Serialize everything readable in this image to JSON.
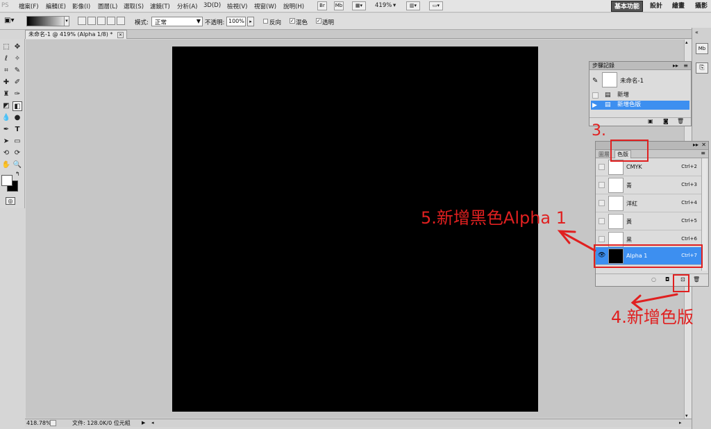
{
  "app_logo": "PS",
  "menu": [
    "檔案(F)",
    "編輯(E)",
    "影像(I)",
    "圖層(L)",
    "選取(S)",
    "濾鏡(T)",
    "分析(A)",
    "3D(D)",
    "檢視(V)",
    "視窗(W)",
    "說明(H)"
  ],
  "menu_icons": {
    "bridge": "Br",
    "mini_bridge": "Mb",
    "zoom": "419%"
  },
  "workspaces": [
    "基本功能",
    "設計",
    "繪畫",
    "攝影"
  ],
  "options": {
    "mode_label": "模式:",
    "mode_value": "正常",
    "opacity_label": "不透明:",
    "opacity_value": "100%",
    "reverse_label": "反向",
    "dither_label": "混色",
    "transparency_label": "透明"
  },
  "document": {
    "tab_title": "未命名-1 @ 419% (Alpha 1/8) *",
    "zoom_status": "418.78%",
    "file_info": "文件: 128.0K/0 位元組",
    "canvas_color": "#000000"
  },
  "history": {
    "title": "步驟記錄",
    "snapshot": "未命名-1",
    "steps": [
      "新增",
      "新增色版"
    ]
  },
  "channels": {
    "tab_layers": "圖層",
    "tab_channels": "色版",
    "rows": [
      {
        "name": "CMYK",
        "shortcut": "Ctrl+2"
      },
      {
        "name": "青",
        "shortcut": "Ctrl+3"
      },
      {
        "name": "洋紅",
        "shortcut": "Ctrl+4"
      },
      {
        "name": "黃",
        "shortcut": "Ctrl+5"
      },
      {
        "name": "黑",
        "shortcut": "Ctrl+6"
      },
      {
        "name": "Alpha 1",
        "shortcut": "Ctrl+7"
      }
    ]
  },
  "annotations": {
    "step3": "3.",
    "step4": "4.新增色版",
    "step5": "5.新增黑色Alpha 1",
    "color": "#e02020"
  },
  "colors": {
    "accent": "#3d8ff0",
    "annotation": "#e02020"
  }
}
